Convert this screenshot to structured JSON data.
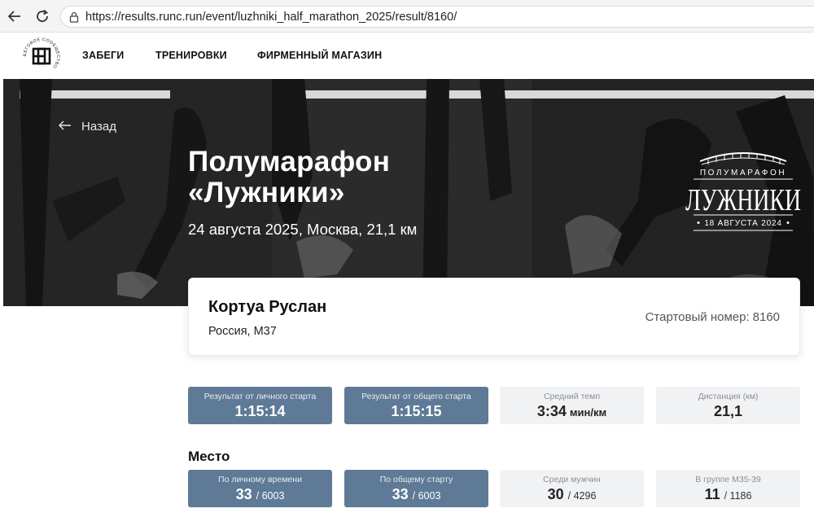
{
  "browser": {
    "url": "https://results.runc.run/event/luzhniki_half_marathon_2025/result/8160/"
  },
  "site": {
    "logo_text": "БЕГОВОЕ СООБЩЕСТВО",
    "menu": [
      "ЗАБЕГИ",
      "ТРЕНИРОВКИ",
      "ФИРМЕННЫЙ МАГАЗИН"
    ]
  },
  "hero": {
    "back_label": "Назад",
    "title_line1": "Полумарафон",
    "title_line2": "«Лужники»",
    "subtitle": "24 августа 2025, Москва, 21,1 км",
    "race_logo": {
      "top": "ПОЛУМАРАФОН",
      "main": "ЛУЖНИКИ",
      "date": "18 АВГУСТА 2024"
    }
  },
  "athlete": {
    "name": "Кортуа Руслан",
    "info": "Россия, M37",
    "bib_label": "Стартовый номер:",
    "bib_number": "8160"
  },
  "results": [
    {
      "label": "Результат от личного старта",
      "value": "1:15:14"
    },
    {
      "label": "Результат от общего старта",
      "value": "1:15:15"
    },
    {
      "label": "Средний темп",
      "value": "3:34",
      "unit": "мин/км"
    },
    {
      "label": "Дистанция (км)",
      "value": "21,1"
    }
  ],
  "place": {
    "title": "Место",
    "items": [
      {
        "label": "По личному времени",
        "value": "33",
        "total": "/ 6003"
      },
      {
        "label": "По общему старту",
        "value": "33",
        "total": "/ 6003"
      },
      {
        "label": "Среди мужчин",
        "value": "30",
        "total": "/ 4296"
      },
      {
        "label": "В группе M35-39",
        "value": "11",
        "total": "/ 1186"
      }
    ]
  },
  "colors": {
    "tile_dark": "#5e7a96",
    "tile_light": "#f1f2f4",
    "hero_bg": "#2d2d2d"
  }
}
